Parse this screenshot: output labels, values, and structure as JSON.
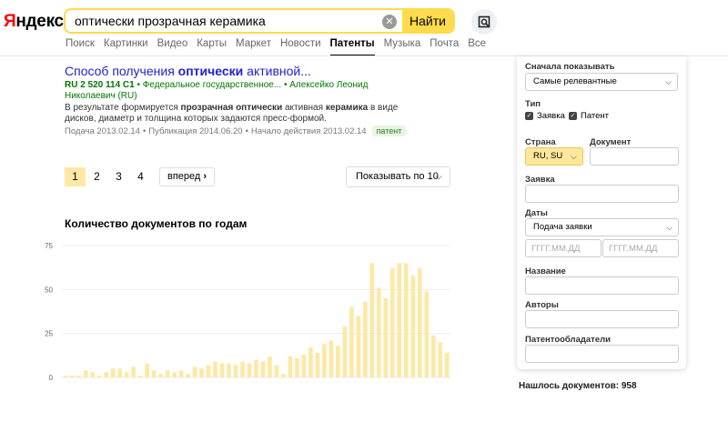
{
  "header": {
    "logo_ya": "Я",
    "logo_rest": "ндекс",
    "search_value": "оптически прозрачная керамика",
    "search_button": "Найти",
    "clear_icon": "close-icon",
    "image_search_icon": "image-search-icon"
  },
  "nav": {
    "items": [
      {
        "label": "Поиск",
        "active": false
      },
      {
        "label": "Картинки",
        "active": false
      },
      {
        "label": "Видео",
        "active": false
      },
      {
        "label": "Карты",
        "active": false
      },
      {
        "label": "Маркет",
        "active": false
      },
      {
        "label": "Новости",
        "active": false
      },
      {
        "label": "Патенты",
        "active": true
      },
      {
        "label": "Музыка",
        "active": false
      },
      {
        "label": "Почта",
        "active": false
      },
      {
        "label": "Все",
        "active": false
      }
    ]
  },
  "result": {
    "title_pre": "Способ получения ",
    "title_bold": "оптически",
    "title_post": " активной...",
    "number": "RU 2 520 114 C1",
    "bullet": " • ",
    "org": "Федеральное государственное...",
    "author": "Алексейко Леонид Николаевич (RU)",
    "snippet_1": "В результате формируется ",
    "snippet_b1": "прозрачная оптически",
    "snippet_2": " активная ",
    "snippet_b2": "керамика",
    "snippet_3": " в виде дисков, диаметр и толщина которых задаются пресс-формой.",
    "filed_label": "Подача",
    "filed": "2013.02.14",
    "published_label": "Публикация",
    "published": "2014.06.20",
    "start_label": "Начало действия",
    "start": "2013.02.14",
    "badge": "патент"
  },
  "pagination": {
    "pages": [
      "1",
      "2",
      "3",
      "4"
    ],
    "active": "1",
    "next": "вперед",
    "per_page": "Показывать по 10"
  },
  "chart_data": {
    "type": "bar",
    "title": "Количество документов по годам",
    "xlabel": "",
    "ylabel": "",
    "ylim": [
      0,
      75
    ],
    "yticks": [
      "0",
      "25",
      "50",
      "75"
    ],
    "grid": true,
    "color": "#fde9a5",
    "values": [
      1,
      1,
      1,
      4,
      3,
      1,
      3,
      5,
      5,
      3,
      6,
      1,
      8,
      4,
      2,
      4,
      3,
      4,
      2,
      6,
      5,
      7,
      9,
      8,
      8,
      7,
      9,
      8,
      10,
      9,
      12,
      7,
      2,
      12,
      11,
      13,
      17,
      14,
      19,
      21,
      18,
      29,
      40,
      35,
      43,
      65,
      51,
      45,
      62,
      65,
      65,
      58,
      62,
      49,
      24,
      20,
      14
    ]
  },
  "sidebar": {
    "sort_label": "Сначала показывать",
    "sort_value": "Самые релевантные",
    "type_label": "Тип",
    "type_application": "Заявка",
    "type_patent": "Патент",
    "country_label": "Страна",
    "country_value": "RU, SU",
    "document_label": "Документ",
    "application_label": "Заявка",
    "dates_label": "Даты",
    "dates_value": "Подача заявки",
    "date_placeholder": "ГГГГ.ММ.ДД",
    "name_label": "Название",
    "authors_label": "Авторы",
    "owners_label": "Патентообладатели"
  },
  "summary": {
    "found": "Нашлось документов: 958"
  }
}
